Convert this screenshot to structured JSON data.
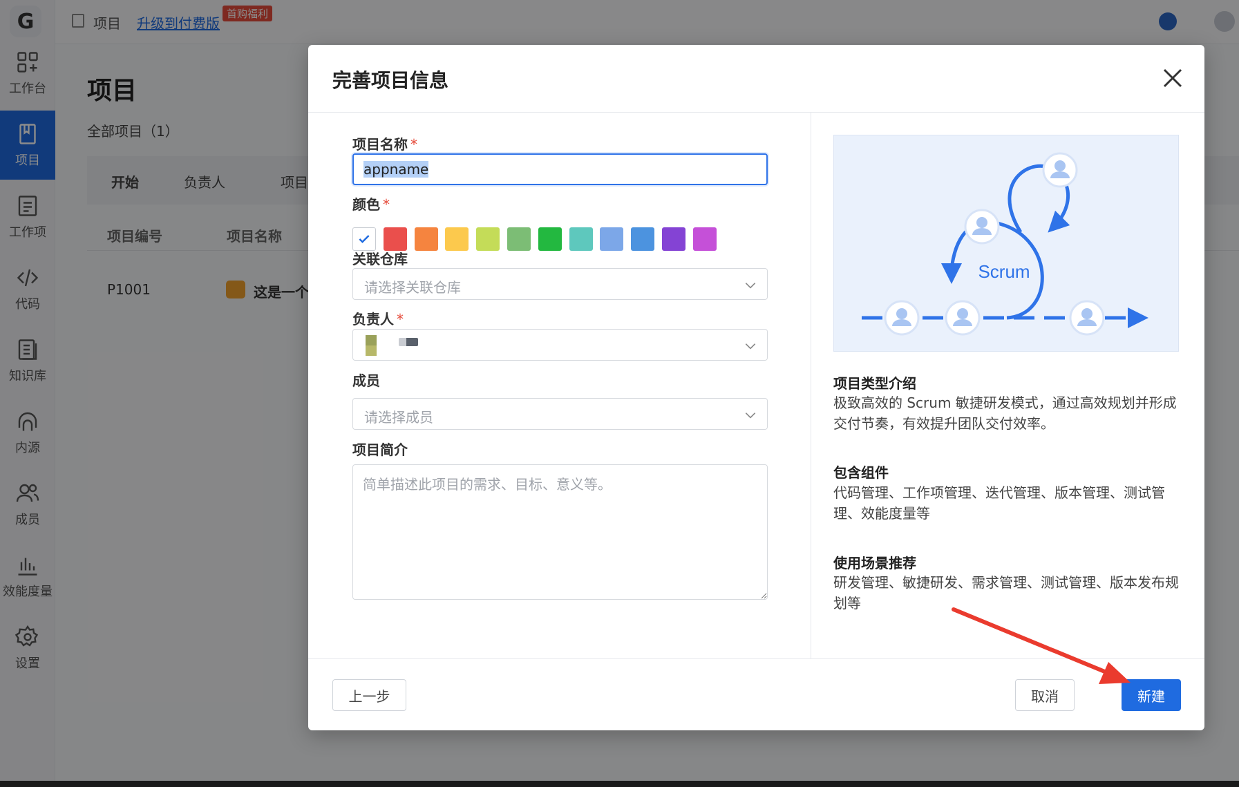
{
  "app": {
    "logo_letter": "G",
    "nav": [
      {
        "label": "工作台",
        "icon": "dashboard-icon"
      },
      {
        "label": "项目",
        "icon": "book-icon",
        "active": true
      },
      {
        "label": "工作项",
        "icon": "checklist-icon"
      },
      {
        "label": "代码",
        "icon": "code-icon"
      },
      {
        "label": "知识库",
        "icon": "document-icon"
      },
      {
        "label": "内源",
        "icon": "headset-icon"
      },
      {
        "label": "成员",
        "icon": "users-icon"
      },
      {
        "label": "效能度量",
        "icon": "chart-icon"
      },
      {
        "label": "设置",
        "icon": "gear-icon"
      }
    ],
    "topbar": {
      "breadcrumb": "项目",
      "upgrade_link": "升级到付费版",
      "promo_badge": "首购福利"
    },
    "page": {
      "title": "项目",
      "subtitle": "全部项目（1）",
      "filters": [
        "开始",
        "负责人",
        "项目"
      ],
      "columns": [
        "项目编号",
        "项目名称"
      ],
      "rows": [
        {
          "id": "P1001",
          "name": "这是一个"
        }
      ]
    }
  },
  "modal": {
    "title": "完善项目信息",
    "fields": {
      "name": {
        "label": "项目名称",
        "value": "appname"
      },
      "color": {
        "label": "颜色"
      },
      "repo": {
        "label": "关联仓库",
        "placeholder": "请选择关联仓库"
      },
      "owner": {
        "label": "负责人"
      },
      "members": {
        "label": "成员",
        "placeholder": "请选择成员"
      },
      "description": {
        "label": "项目简介",
        "placeholder": "简单描述此项目的需求、目标、意义等。"
      }
    },
    "colors": [
      "#ffffff",
      "#ea4f4c",
      "#f5843f",
      "#fcc94d",
      "#c4dc58",
      "#7cbd75",
      "#23b840",
      "#5ec8bd",
      "#7ca7e8",
      "#4c93df",
      "#8443d4",
      "#c550d8"
    ],
    "selected_color_index": 0,
    "illustration": {
      "label": "Scrum"
    },
    "info": [
      {
        "heading": "项目类型介绍",
        "text": "极致高效的 Scrum 敏捷研发模式，通过高效规划并形成交付节奏，有效提升团队交付效率。"
      },
      {
        "heading": "包含组件",
        "text": "代码管理、工作项管理、迭代管理、版本管理、测试管理、效能度量等"
      },
      {
        "heading": "使用场景推荐",
        "text": "研发管理、敏捷研发、需求管理、测试管理、版本发布规划等"
      }
    ],
    "buttons": {
      "prev": "上一步",
      "cancel": "取消",
      "create": "新建"
    }
  },
  "accent_color": "#1f6be0"
}
